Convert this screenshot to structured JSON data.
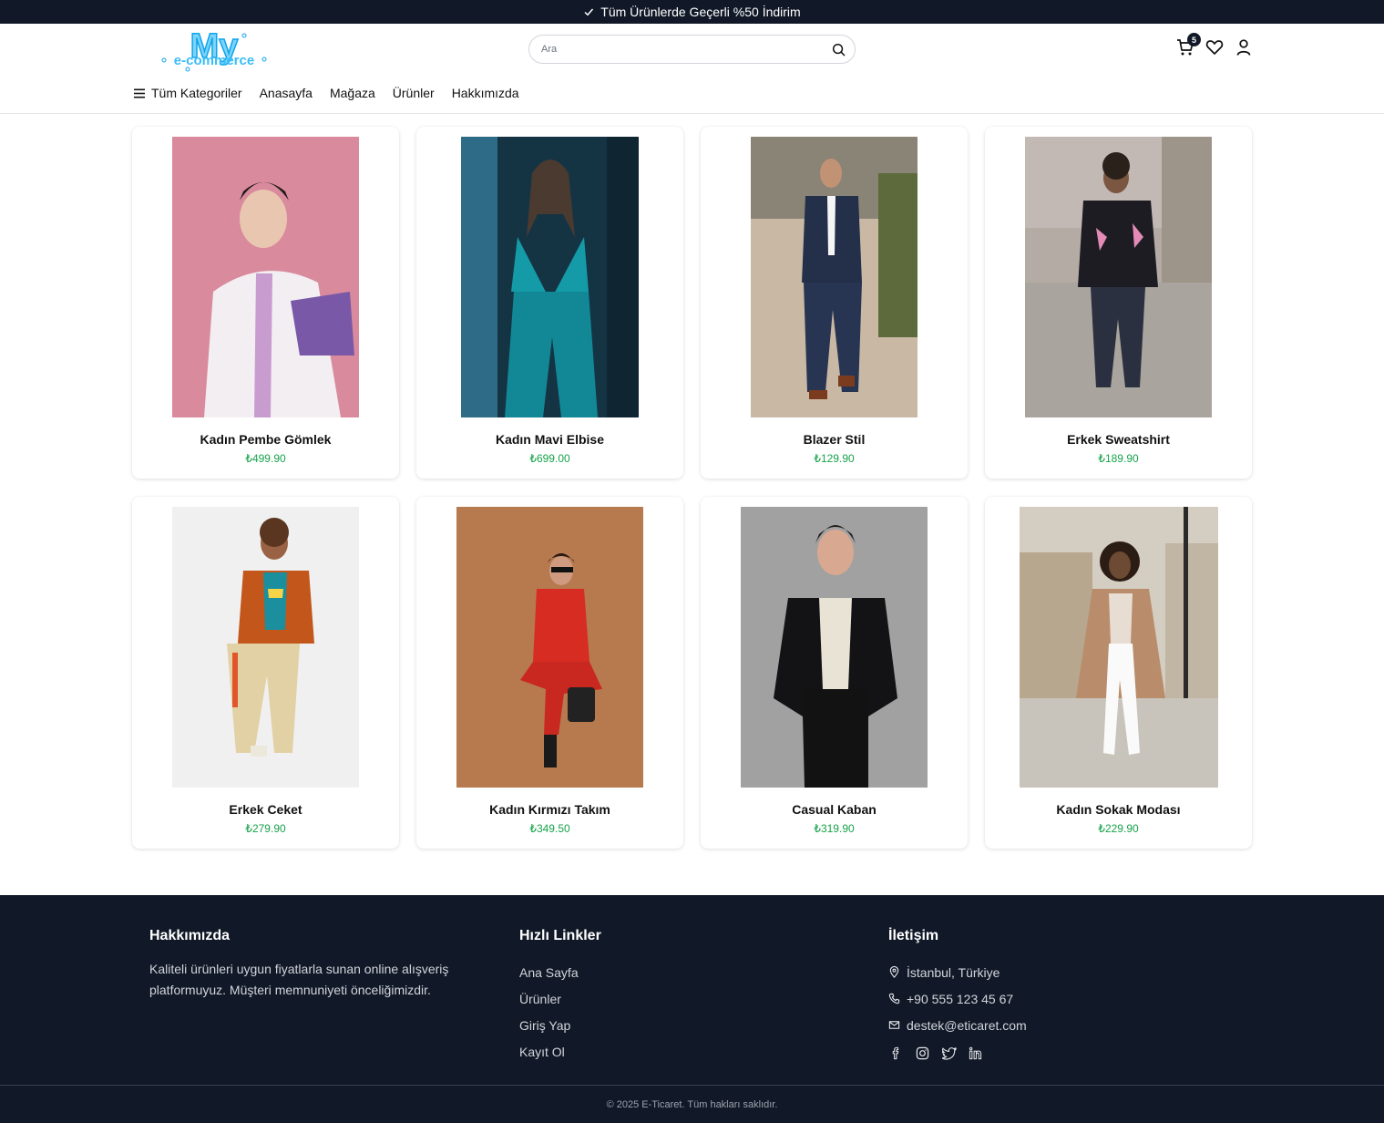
{
  "promo": {
    "text": "Tüm Ürünlerde Geçerli %50 İndirim"
  },
  "brand": {
    "logo_top": "My",
    "logo_bottom": "e-commerce"
  },
  "search": {
    "placeholder": "Ara"
  },
  "header_icons": {
    "cart_count": "5"
  },
  "nav": {
    "all_categories": "Tüm Kategoriler",
    "items": [
      "Anasayfa",
      "Mağaza",
      "Ürünler",
      "Hakkımızda"
    ]
  },
  "products": [
    {
      "name": "Kadın Pembe Gömlek",
      "price": "₺499.90"
    },
    {
      "name": "Kadın Mavi Elbise",
      "price": "₺699.00"
    },
    {
      "name": "Blazer Stil",
      "price": "₺129.90"
    },
    {
      "name": "Erkek Sweatshirt",
      "price": "₺189.90"
    },
    {
      "name": "Erkek Ceket",
      "price": "₺279.90"
    },
    {
      "name": "Kadın Kırmızı Takım",
      "price": "₺349.50"
    },
    {
      "name": "Casual Kaban",
      "price": "₺319.90"
    },
    {
      "name": "Kadın Sokak Modası",
      "price": "₺229.90"
    }
  ],
  "footer": {
    "about": {
      "title": "Hakkımızda",
      "text": "Kaliteli ürünleri uygun fiyatlarla sunan online alışveriş platformuyuz. Müşteri memnuniyeti önceliğimizdir."
    },
    "quick_links": {
      "title": "Hızlı Linkler",
      "items": [
        "Ana Sayfa",
        "Ürünler",
        "Giriş Yap",
        "Kayıt Ol"
      ]
    },
    "contact": {
      "title": "İletişim",
      "address": "İstanbul, Türkiye",
      "phone": "+90 555 123 45 67",
      "email": "destek@eticaret.com"
    },
    "copyright": "© 2025 E-Ticaret. Tüm hakları saklıdır."
  },
  "colors": {
    "dark": "#111827",
    "price_green": "#16a34a",
    "logo_blue": "#38bdf8"
  }
}
